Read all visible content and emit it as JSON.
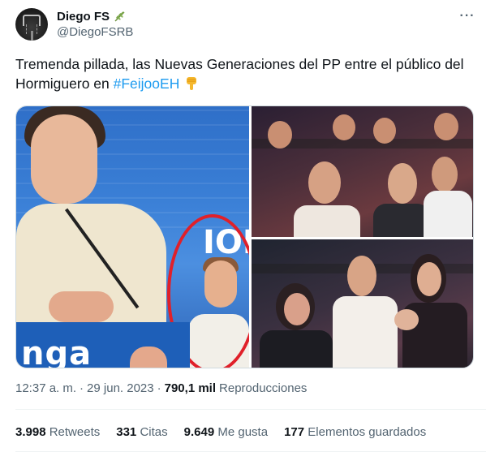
{
  "author": {
    "display_name": "Diego FS",
    "handle": "@DiegoFSRB",
    "badge_icon": "olive-branch-icon"
  },
  "tweet": {
    "text_before": "Tremenda pillada, las Nuevas Generaciones del PP entre el público del Hormiguero en ",
    "hashtag": "#FeijooEH",
    "trailing_icon": "pointing-down-emoji",
    "hashtag_color": "#1d9bf0"
  },
  "media": {
    "lectern_text": "nga",
    "backdrop_text": "ION"
  },
  "meta": {
    "time": "12:37 a. m.",
    "separator": "·",
    "date": "29 jun. 2023",
    "views_separator": "·",
    "views_count": "790,1 mil",
    "views_label": "Reproducciones"
  },
  "stats": {
    "retweets_count": "3.998",
    "retweets_label": "Retweets",
    "quotes_count": "331",
    "quotes_label": "Citas",
    "likes_count": "9.649",
    "likes_label": "Me gusta",
    "bookmarks_count": "177",
    "bookmarks_label": "Elementos guardados"
  },
  "colors": {
    "text": "#0f1419",
    "secondary": "#536471",
    "accent": "#1d9bf0",
    "highlight_circle": "#e0202a"
  }
}
